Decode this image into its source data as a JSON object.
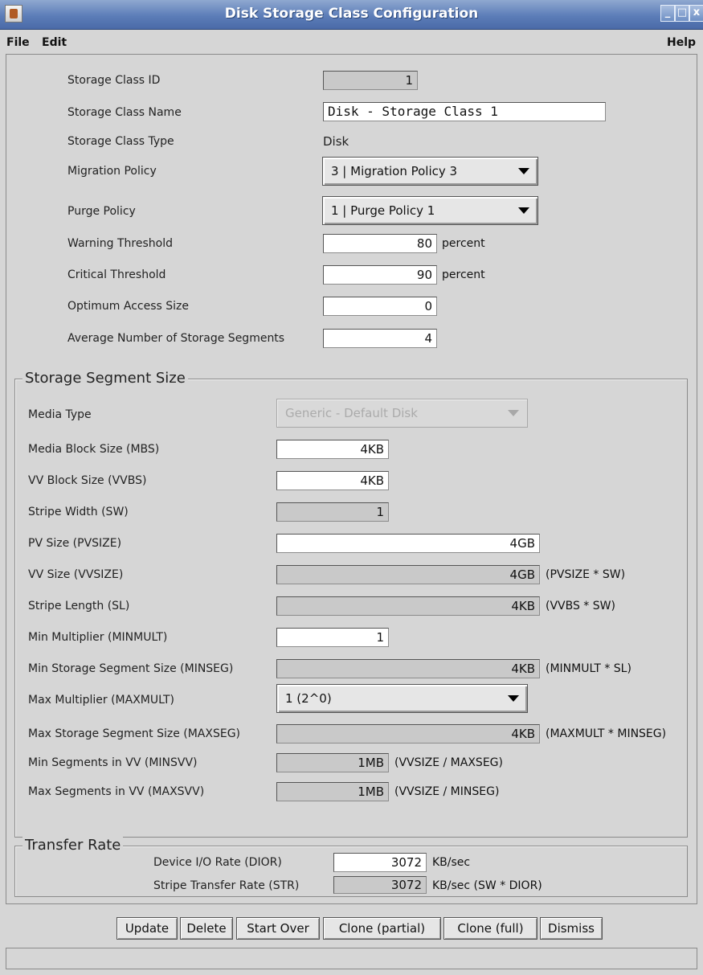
{
  "window": {
    "title": "Disk Storage Class Configuration",
    "min": "_",
    "max": "□",
    "close": "x"
  },
  "menu": {
    "file": "File",
    "edit": "Edit",
    "help": "Help"
  },
  "general": {
    "id_label": "Storage Class ID",
    "id_value": "1",
    "name_label": "Storage Class Name",
    "name_value": "Disk - Storage Class 1",
    "type_label": "Storage Class Type",
    "type_value": "Disk",
    "migration_label": "Migration Policy",
    "migration_value": "3 | Migration Policy 3",
    "purge_label": "Purge Policy",
    "purge_value": "1 | Purge Policy 1",
    "warning_label": "Warning Threshold",
    "warning_value": "80",
    "warning_unit": "percent",
    "critical_label": "Critical Threshold",
    "critical_value": "90",
    "critical_unit": "percent",
    "optimum_label": "Optimum Access Size",
    "optimum_value": "0",
    "avg_segments_label": "Average Number of Storage Segments",
    "avg_segments_value": "4"
  },
  "segment": {
    "title": "Storage Segment Size",
    "media_type_label": "Media Type",
    "media_type_value": "Generic - Default Disk",
    "mbs_label": "Media Block Size (MBS)",
    "mbs_value": "4KB",
    "vvbs_label": "VV Block Size (VVBS)",
    "vvbs_value": "4KB",
    "sw_label": "Stripe Width (SW)",
    "sw_value": "1",
    "pvsize_label": "PV Size (PVSIZE)",
    "pvsize_value": "4GB",
    "vvsize_label": "VV Size (VVSIZE)",
    "vvsize_value": "4GB",
    "vvsize_note": "(PVSIZE * SW)",
    "sl_label": "Stripe Length (SL)",
    "sl_value": "4KB",
    "sl_note": "(VVBS * SW)",
    "minmult_label": "Min Multiplier (MINMULT)",
    "minmult_value": "1",
    "minseg_label": "Min Storage Segment Size (MINSEG)",
    "minseg_value": "4KB",
    "minseg_note": "(MINMULT * SL)",
    "maxmult_label": "Max Multiplier (MAXMULT)",
    "maxmult_value": "1 (2^0)",
    "maxseg_label": "Max Storage Segment Size (MAXSEG)",
    "maxseg_value": "4KB",
    "maxseg_note": "(MAXMULT * MINSEG)",
    "minsvv_label": "Min Segments in VV (MINSVV)",
    "minsvv_value": "1MB",
    "minsvv_note": "(VVSIZE / MAXSEG)",
    "maxsvv_label": "Max Segments in VV (MAXSVV)",
    "maxsvv_value": "1MB",
    "maxsvv_note": "(VVSIZE / MINSEG)"
  },
  "transfer": {
    "title": "Transfer Rate",
    "dior_label": "Device I/O Rate (DIOR)",
    "dior_value": "3072",
    "dior_unit": "KB/sec",
    "str_label": "Stripe Transfer Rate (STR)",
    "str_value": "3072",
    "str_unit": "KB/sec (SW * DIOR)"
  },
  "buttons": {
    "update": "Update",
    "delete": "Delete",
    "start_over": "Start Over",
    "clone_partial": "Clone (partial)",
    "clone_full": "Clone (full)",
    "dismiss": "Dismiss"
  },
  "status": ""
}
